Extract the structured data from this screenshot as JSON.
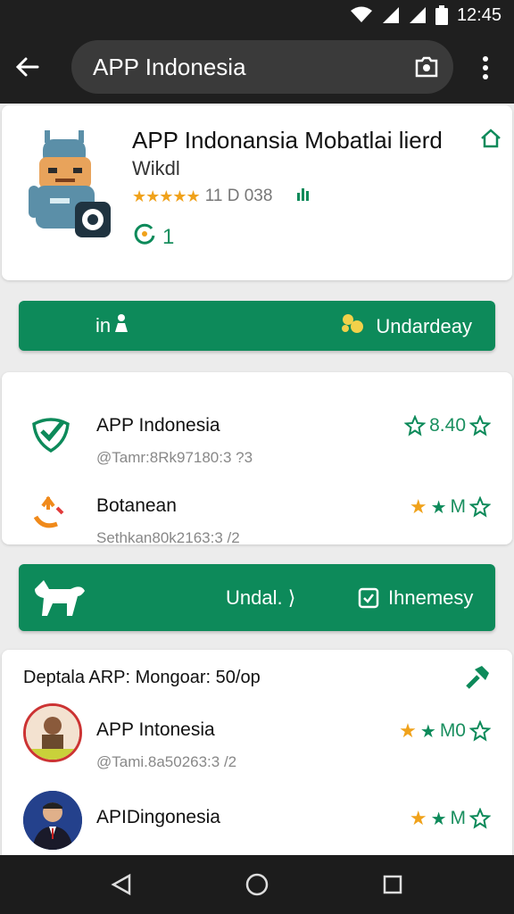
{
  "status": {
    "time": "12:45"
  },
  "search": {
    "query": "APP Indonesia"
  },
  "hero": {
    "title": "APP Indonansia Mobatlai lierd",
    "subtitle": "Wikdl",
    "rating_text": "11 D 038",
    "count": "1"
  },
  "action_bar_1": {
    "left_label": "in",
    "right_label": "Undardeay"
  },
  "list1": {
    "items": [
      {
        "title": "APP Indonesia",
        "sub": "@Tamr:8Rk97180:3 ?3",
        "rating": "8.40"
      },
      {
        "title": "Botanean",
        "sub": "Sethkan80k2163:3 /2",
        "rating": "M"
      }
    ]
  },
  "action_bar_2": {
    "mid_label": "Undal. ⟩",
    "right_label": "Ihnemesy"
  },
  "list2": {
    "title": "Deptala ARP: Mongoar: 50/op",
    "items": [
      {
        "title": "APP Intonesia",
        "sub": "@Tami.8a50263:3 /2",
        "rating": "M0"
      },
      {
        "title": "APIDingonesia",
        "sub": "",
        "rating": "M"
      }
    ]
  },
  "colors": {
    "brand_green": "#0d8a5a",
    "star": "#f0a21b",
    "dark_bar": "#1f1f1f"
  }
}
